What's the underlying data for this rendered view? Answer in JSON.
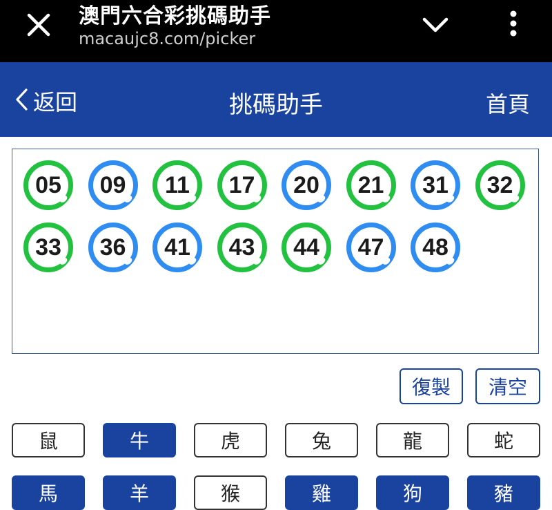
{
  "browser": {
    "title": "澳門六合彩挑碼助手",
    "url": "macaujc8.com/picker",
    "icons": {
      "close": "close-icon",
      "expand": "chevron-down-icon",
      "menu": "more-vertical-icon"
    },
    "color": "#000000"
  },
  "header": {
    "back_label": "返回",
    "title": "挑碼助手",
    "home_label": "首頁",
    "color": "#1a43a0"
  },
  "picked": {
    "colors": {
      "green": "#22c240",
      "blue": "#2f8cf0"
    },
    "numbers": [
      {
        "num": "05",
        "color": "green"
      },
      {
        "num": "09",
        "color": "blue"
      },
      {
        "num": "11",
        "color": "green"
      },
      {
        "num": "17",
        "color": "green"
      },
      {
        "num": "20",
        "color": "blue"
      },
      {
        "num": "21",
        "color": "green"
      },
      {
        "num": "31",
        "color": "blue"
      },
      {
        "num": "32",
        "color": "green"
      },
      {
        "num": "33",
        "color": "green"
      },
      {
        "num": "36",
        "color": "blue"
      },
      {
        "num": "41",
        "color": "blue"
      },
      {
        "num": "43",
        "color": "green"
      },
      {
        "num": "44",
        "color": "green"
      },
      {
        "num": "47",
        "color": "blue"
      },
      {
        "num": "48",
        "color": "blue"
      }
    ]
  },
  "actions": {
    "copy_label": "復製",
    "clear_label": "清空"
  },
  "zodiac": [
    {
      "label": "鼠",
      "selected": false
    },
    {
      "label": "牛",
      "selected": true
    },
    {
      "label": "虎",
      "selected": false
    },
    {
      "label": "兔",
      "selected": false
    },
    {
      "label": "龍",
      "selected": false
    },
    {
      "label": "蛇",
      "selected": false
    },
    {
      "label": "馬",
      "selected": true
    },
    {
      "label": "羊",
      "selected": true
    },
    {
      "label": "猴",
      "selected": false
    },
    {
      "label": "雞",
      "selected": true
    },
    {
      "label": "狗",
      "selected": true
    },
    {
      "label": "豬",
      "selected": true
    }
  ]
}
